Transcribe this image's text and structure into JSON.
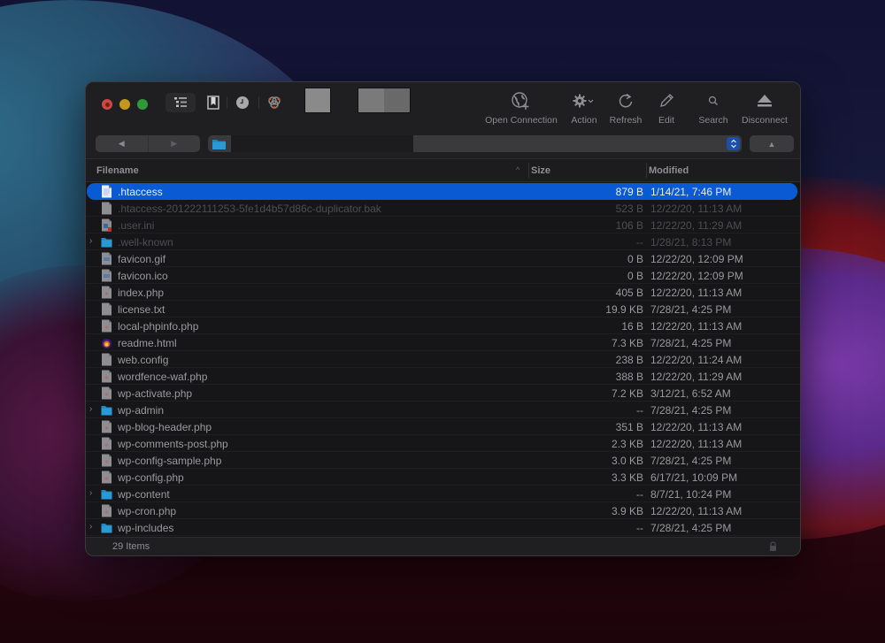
{
  "toolbar": {
    "tools": [
      {
        "label": "Open Connection",
        "icon": "globe-plus-icon"
      },
      {
        "label": "Action",
        "icon": "gear-dropdown-icon"
      },
      {
        "label": "Refresh",
        "icon": "refresh-icon"
      },
      {
        "label": "Edit",
        "icon": "pencil-icon"
      },
      {
        "label": "Search",
        "icon": "search-icon"
      },
      {
        "label": "Disconnect",
        "icon": "eject-icon"
      }
    ],
    "view_icons": [
      "outline-view-icon",
      "bookmarks-icon",
      "history-icon",
      "bonjour-icon"
    ]
  },
  "navigation": {
    "back": "◀",
    "forward": "▶",
    "up": "▲",
    "path_icon": "folder-icon"
  },
  "columns": {
    "filename": "Filename",
    "size": "Size",
    "modified": "Modified",
    "sort_indicator": "^"
  },
  "files": [
    {
      "name": ".htaccess",
      "size": "879 B",
      "modified": "1/14/21, 7:46 PM",
      "type": "text",
      "selected": true,
      "dim": false,
      "folder": false
    },
    {
      "name": ".htaccess-201222111253-5fe1d4b57d86c-duplicator.bak",
      "size": "523 B",
      "modified": "12/22/20, 11:13 AM",
      "type": "doc",
      "selected": false,
      "dim": true,
      "folder": false
    },
    {
      "name": ".user.ini",
      "size": "106 B",
      "modified": "12/22/20, 11:29 AM",
      "type": "ini",
      "selected": false,
      "dim": true,
      "folder": false
    },
    {
      "name": ".well-known",
      "size": "--",
      "modified": "1/28/21, 8:13 PM",
      "type": "folder",
      "selected": false,
      "dim": true,
      "folder": true
    },
    {
      "name": "favicon.gif",
      "size": "0 B",
      "modified": "12/22/20, 12:09 PM",
      "type": "image",
      "selected": false,
      "dim": false,
      "folder": false
    },
    {
      "name": "favicon.ico",
      "size": "0 B",
      "modified": "12/22/20, 12:09 PM",
      "type": "image",
      "selected": false,
      "dim": false,
      "folder": false
    },
    {
      "name": "index.php",
      "size": "405 B",
      "modified": "12/22/20, 11:13 AM",
      "type": "php",
      "selected": false,
      "dim": false,
      "folder": false
    },
    {
      "name": "license.txt",
      "size": "19.9 KB",
      "modified": "7/28/21, 4:25 PM",
      "type": "doc",
      "selected": false,
      "dim": false,
      "folder": false
    },
    {
      "name": "local-phpinfo.php",
      "size": "16 B",
      "modified": "12/22/20, 11:13 AM",
      "type": "php",
      "selected": false,
      "dim": false,
      "folder": false
    },
    {
      "name": "readme.html",
      "size": "7.3 KB",
      "modified": "7/28/21, 4:25 PM",
      "type": "html",
      "selected": false,
      "dim": false,
      "folder": false
    },
    {
      "name": "web.config",
      "size": "238 B",
      "modified": "12/22/20, 11:24 AM",
      "type": "doc",
      "selected": false,
      "dim": false,
      "folder": false
    },
    {
      "name": "wordfence-waf.php",
      "size": "388 B",
      "modified": "12/22/20, 11:29 AM",
      "type": "php",
      "selected": false,
      "dim": false,
      "folder": false
    },
    {
      "name": "wp-activate.php",
      "size": "7.2 KB",
      "modified": "3/12/21, 6:52 AM",
      "type": "php",
      "selected": false,
      "dim": false,
      "folder": false
    },
    {
      "name": "wp-admin",
      "size": "--",
      "modified": "7/28/21, 4:25 PM",
      "type": "folder",
      "selected": false,
      "dim": false,
      "folder": true
    },
    {
      "name": "wp-blog-header.php",
      "size": "351 B",
      "modified": "12/22/20, 11:13 AM",
      "type": "php",
      "selected": false,
      "dim": false,
      "folder": false
    },
    {
      "name": "wp-comments-post.php",
      "size": "2.3 KB",
      "modified": "12/22/20, 11:13 AM",
      "type": "php",
      "selected": false,
      "dim": false,
      "folder": false
    },
    {
      "name": "wp-config-sample.php",
      "size": "3.0 KB",
      "modified": "7/28/21, 4:25 PM",
      "type": "php",
      "selected": false,
      "dim": false,
      "folder": false
    },
    {
      "name": "wp-config.php",
      "size": "3.3 KB",
      "modified": "6/17/21, 10:09 PM",
      "type": "php",
      "selected": false,
      "dim": false,
      "folder": false
    },
    {
      "name": "wp-content",
      "size": "--",
      "modified": "8/7/21, 10:24 PM",
      "type": "folder",
      "selected": false,
      "dim": false,
      "folder": true
    },
    {
      "name": "wp-cron.php",
      "size": "3.9 KB",
      "modified": "12/22/20, 11:13 AM",
      "type": "php",
      "selected": false,
      "dim": false,
      "folder": false
    },
    {
      "name": "wp-includes",
      "size": "--",
      "modified": "7/28/21, 4:25 PM",
      "type": "folder",
      "selected": false,
      "dim": false,
      "folder": true
    }
  ],
  "status": {
    "item_count": "29 Items"
  },
  "colors": {
    "selection": "#0a5bd3",
    "folder": "#1f86c4",
    "window_bg": "#1e1e21"
  }
}
